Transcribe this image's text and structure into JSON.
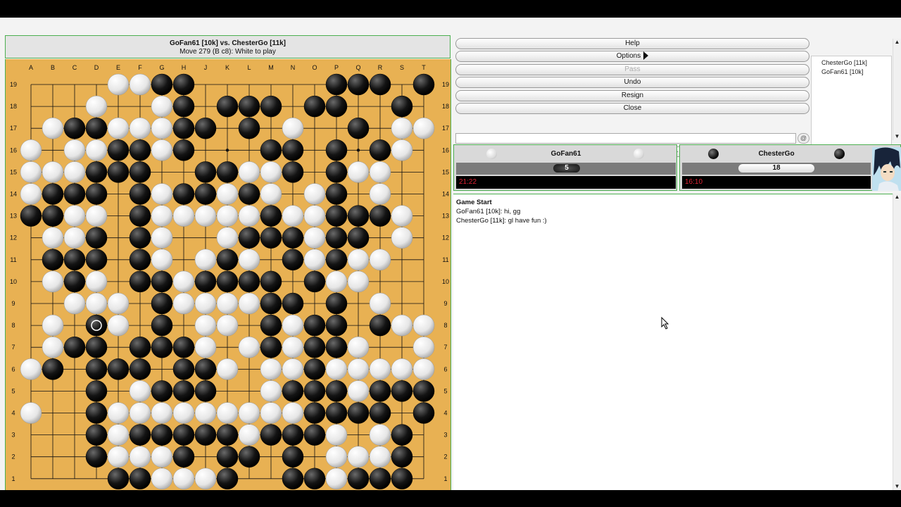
{
  "header": {
    "title": "GoFan61 [10k] vs. ChesterGo [11k]",
    "subtitle": "Move 279 (B c8): White to play"
  },
  "board": {
    "columns": [
      "A",
      "B",
      "C",
      "D",
      "E",
      "F",
      "G",
      "H",
      "J",
      "K",
      "L",
      "M",
      "N",
      "O",
      "P",
      "Q",
      "R",
      "S",
      "T"
    ],
    "rows": [
      "....WWBB......BBB.B",
      "...W..WB.BBB.BB..B.",
      ".WBBWWWBB.B.W..B.WW",
      "W.WWBBWB...BB.B.BW.",
      "WWWBBB..BBWWB.BWW..",
      "WBBB.BWBBWBW.WB.W..",
      "BBWW.BWWWWWBWWBBBW.",
      ".WWB.BW..WBBBWBB.W.",
      ".BBB.BW.WBW.BWBWW..",
      ".WBW.BBWBBBB.BWW...",
      "..WWW.BWWWWBB.B.W..",
      ".W.CW.B.WW.BWBB.BWW",
      ".WBB.BBBW.WBWBBW..W",
      "WB.BBB.BBW.WWBWWWWW",
      "...B.WBBB..WBBBWBBB",
      "W..BWWWWWWWWWBBBB.B",
      "...BWBBBBBWBBBW.WB.",
      "...BWWWB.BB.B.WWWB.",
      "....BBWWWB..BBWBBB.B"
    ],
    "last_move": "c8"
  },
  "controls": {
    "help": "Help",
    "options": "Options",
    "pass": "Pass",
    "undo": "Undo",
    "resign": "Resign",
    "close": "Close"
  },
  "chat_input": {
    "value": "",
    "placeholder": ""
  },
  "nav": {
    "first": "⏮",
    "prev": "◀",
    "next": "▶",
    "last": "⏭"
  },
  "players_list": [
    "ChesterGo [11k]",
    "GoFan61 [10k]"
  ],
  "white_player": {
    "name": "GoFan61",
    "captures": "5",
    "clock": "21:22",
    "color": "white"
  },
  "black_player": {
    "name": "ChesterGo",
    "captures": "18",
    "clock": "16:10",
    "color": "black"
  },
  "chat": {
    "heading": "Game Start",
    "messages": [
      "GoFan61 [10k]: hi, gg",
      "ChesterGo [11k]: gl have fun :)"
    ]
  },
  "colors": {
    "board": "#e8b153",
    "accent": "#4caf50",
    "clock_text": "#d22233"
  },
  "icons": {
    "avatar": "anime-avatar",
    "send": "send-icon"
  }
}
